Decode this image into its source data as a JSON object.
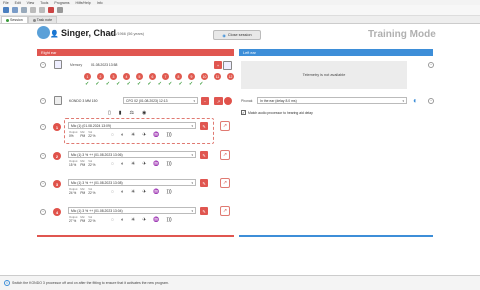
{
  "menu": [
    "File",
    "Edit",
    "View",
    "Tools",
    "Programs",
    "Hilfe/Help",
    "Info"
  ],
  "tabs": [
    {
      "label": "Session",
      "active": true
    },
    {
      "label": "Task note",
      "active": false
    }
  ],
  "patient": {
    "name": "Singer, Chad",
    "sub": "12/1/1966 (56 years)"
  },
  "close_session_label": "Close session",
  "mode_title": "Training Mode",
  "right_ear": {
    "header": "Right ear",
    "memory_label": "Memory",
    "memory_date": "01.08.2023 13:58",
    "memory_numbers": [
      "1",
      "2",
      "3",
      "4",
      "5",
      "6",
      "7",
      "8",
      "9",
      "10",
      "11",
      "12"
    ],
    "device_name": "KONDO 3 MM 150",
    "cfg_dropdown": "CFG 02 (01.08.2023) 12:13",
    "programs": [
      {
        "num": "1",
        "dropdown": "Mic (1) (01.08.2024 13:09)",
        "label1": "Output",
        "val1": "0%",
        "label2": "Mic",
        "val2": "PM",
        "label3": "Vol",
        "val3": "22 %",
        "highlighted": true
      },
      {
        "num": "2",
        "dropdown": "Mic (1) 3 % ++ (01.08.2023 13:06)",
        "label1": "Output",
        "val1": "15 %",
        "label2": "Mic",
        "val2": "PM",
        "label3": "Vol",
        "val3": "22 %",
        "highlighted": false
      },
      {
        "num": "3",
        "dropdown": "Mic (1) 3 % ++ (01.08.2023 13:08)",
        "label1": "Output",
        "val1": "24 %",
        "label2": "Mic",
        "val2": "PM",
        "label3": "Vol",
        "val3": "22 %",
        "highlighted": false
      },
      {
        "num": "4",
        "dropdown": "Mic (1) 3 % ++ (01.08.2023 13:04)",
        "label1": "Output",
        "val1": "27 %",
        "label2": "Mic",
        "val2": "PM",
        "label3": "Vol",
        "val3": "22 %",
        "highlighted": false
      }
    ]
  },
  "left_ear": {
    "header": "Left ear",
    "telemetry": "Telemetry is not available",
    "phonak_label": "Phonak",
    "phonak_dropdown": "In the ear (delay 8.0 ms)",
    "match_checkbox_label": "Match audio processor to hearing aid delay",
    "match_checked": true
  },
  "status_text": "Switch the KONDO 3 processor off and on after the fitting to ensure that it activates the new program.",
  "colors": {
    "red": "#e05650",
    "blue": "#3d8ed8",
    "green": "#3a9a3a"
  },
  "icons": {
    "sidebtn": "−",
    "dropdown_arrow": "▾",
    "pencil": "✎",
    "edit": "↗",
    "checkmark": "✓",
    "info": "i",
    "plus": "+",
    "user": "👤",
    "close": "◉",
    "ear": "◐",
    "chevron": "⌄"
  }
}
